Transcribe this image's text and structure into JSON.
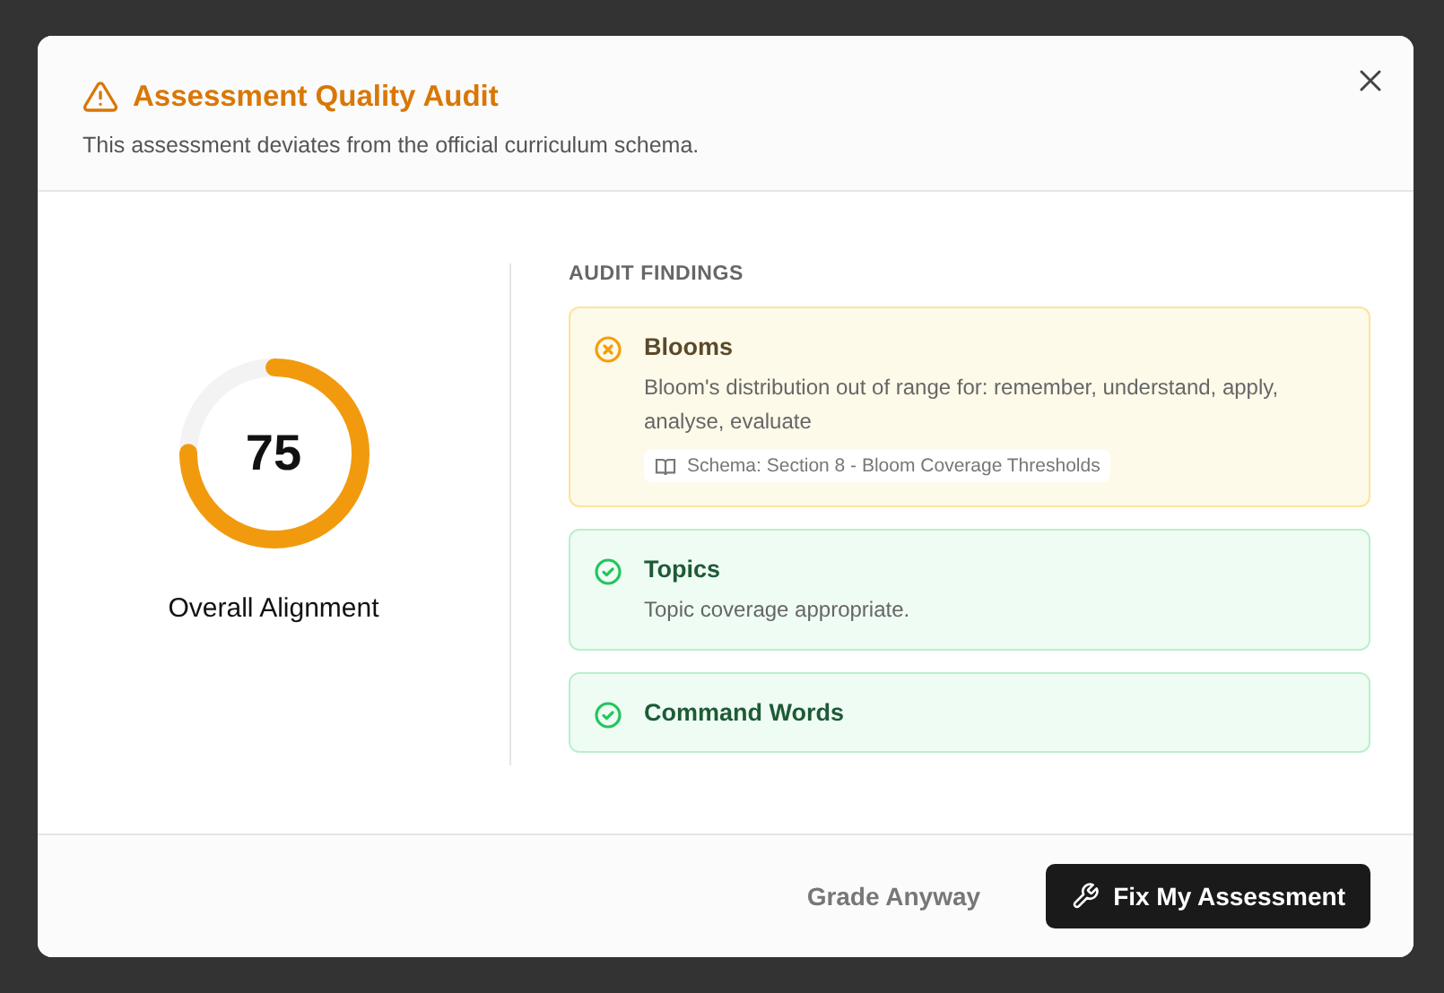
{
  "dialog": {
    "title": "Assessment Quality Audit",
    "subtitle": "This assessment deviates from the official curriculum schema.",
    "score": {
      "value": "75",
      "level": 0.75,
      "label": "Overall Alignment"
    },
    "findings_heading": "AUDIT FINDINGS",
    "findings": [
      {
        "kind": "warning",
        "title": "Blooms",
        "message": "Bloom's distribution out of range for: remember, understand, apply, analyse, evaluate",
        "reference": "Schema: Section 8 - Bloom Coverage Thresholds"
      },
      {
        "kind": "pass",
        "title": "Topics",
        "message": "Topic coverage appropriate."
      },
      {
        "kind": "pass",
        "title": "Command Words"
      }
    ],
    "secondary_button": "Grade Anyway",
    "primary_button": "Fix My Assessment"
  }
}
